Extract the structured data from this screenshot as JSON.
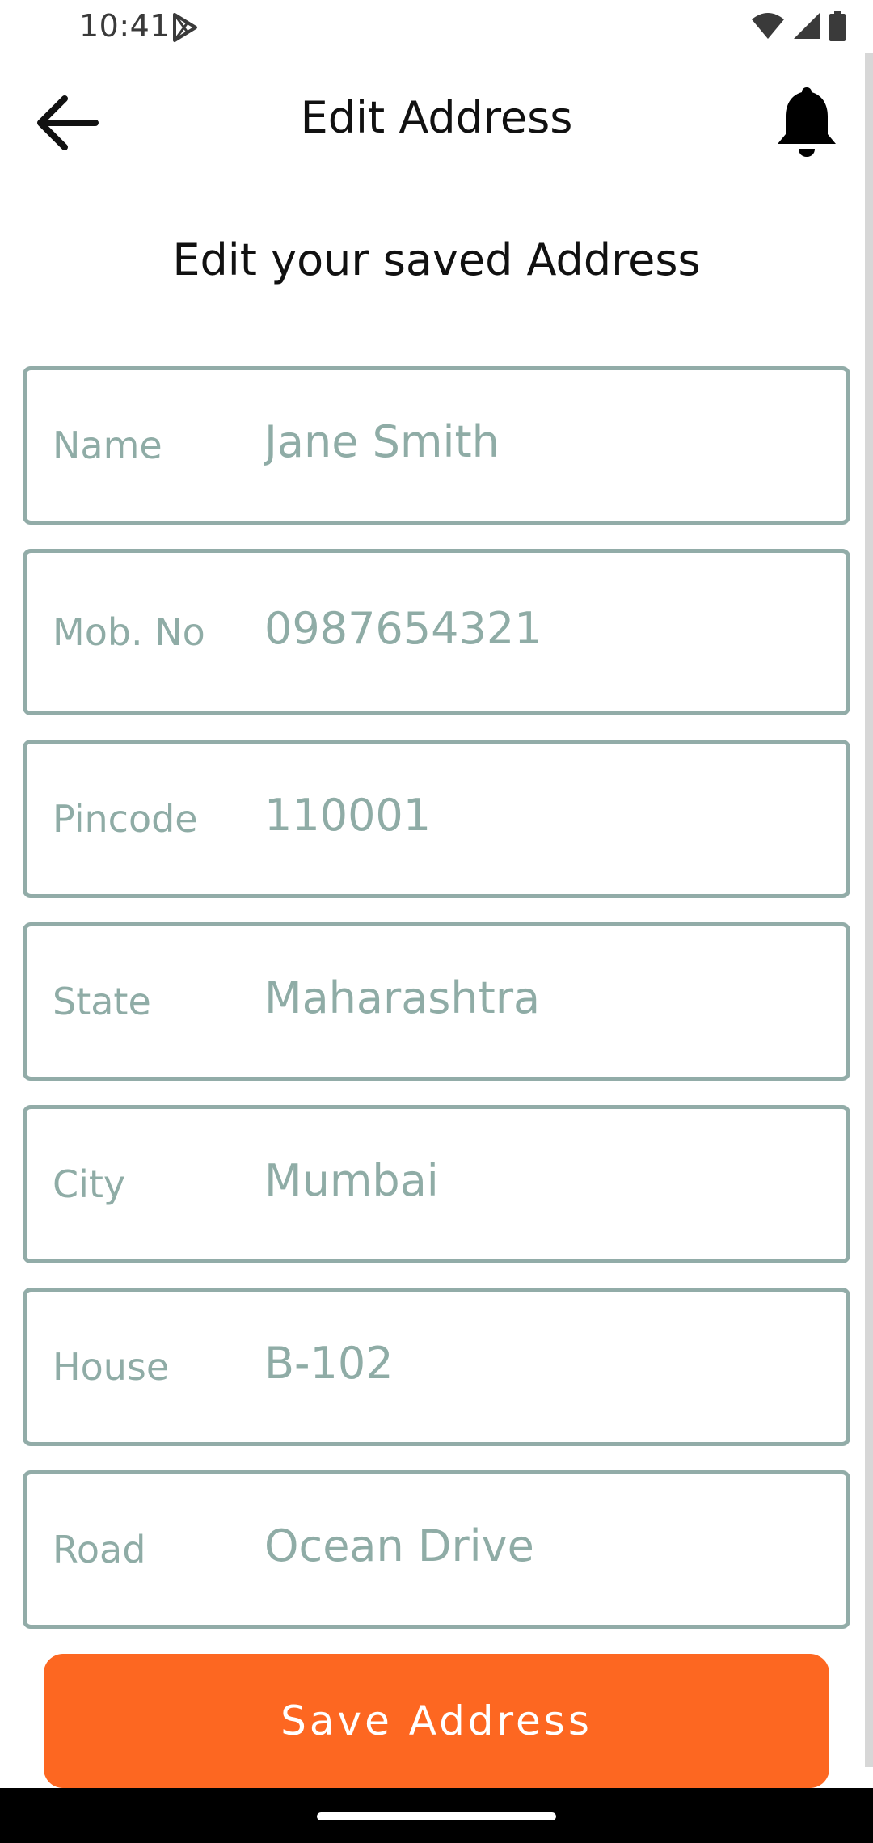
{
  "status_bar": {
    "time": "10:41",
    "play_icon": "play-store-icon",
    "wifi_icon": "wifi-icon",
    "signal_icon": "cell-signal-icon",
    "battery_icon": "battery-icon"
  },
  "header": {
    "title": "Edit Address",
    "back_icon": "arrow-left-icon",
    "bell_icon": "bell-icon"
  },
  "subtitle": "Edit your saved Address",
  "form": {
    "fields": [
      {
        "label": "Name",
        "value": "Jane Smith"
      },
      {
        "label": "Mob. No",
        "value": "0987654321"
      },
      {
        "label": "Pincode",
        "value": "110001"
      },
      {
        "label": "State",
        "value": "Maharashtra"
      },
      {
        "label": "City",
        "value": "Mumbai"
      },
      {
        "label": "House",
        "value": "B-102"
      },
      {
        "label": "Road",
        "value": "Ocean Drive"
      }
    ]
  },
  "actions": {
    "save_label": "Save Address"
  },
  "colors": {
    "accent": "#fd6721",
    "field_border": "#92aca8",
    "field_text": "#8faca6",
    "text_primary": "#111111"
  }
}
